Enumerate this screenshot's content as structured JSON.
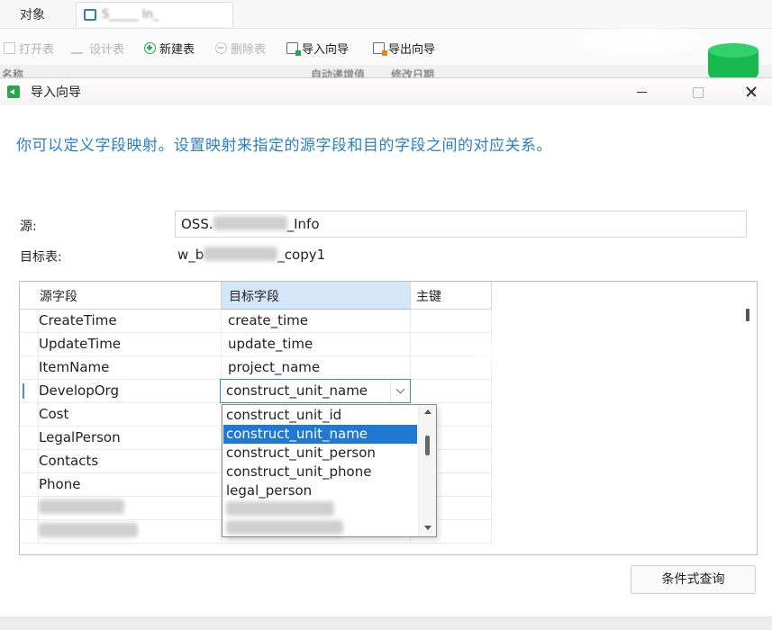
{
  "app": {
    "object_tab_label": "对象",
    "doc_tab_title": "S_____ In_",
    "toolbar": [
      {
        "label": "打开表",
        "enabled": false,
        "icon": "open-table-icon"
      },
      {
        "label": "设计表",
        "enabled": false,
        "icon": "design-table-icon"
      },
      {
        "label": "新建表",
        "enabled": true,
        "icon": "new-table-icon"
      },
      {
        "label": "删除表",
        "enabled": false,
        "icon": "delete-table-icon"
      },
      {
        "label": "导入向导",
        "enabled": true,
        "icon": "import-wizard-icon"
      },
      {
        "label": "导出向导",
        "enabled": true,
        "icon": "export-wizard-icon"
      }
    ],
    "column_headers": [
      "名称",
      "自动递增值",
      "修改日期"
    ],
    "colors": {
      "accent": "#1f78d1",
      "heading": "#2f7fc0",
      "success": "#2aa74a"
    }
  },
  "dialog": {
    "title": "导入向导",
    "instruction": "你可以定义字段映射。设置映射来指定的源字段和目的字段之间的对应关系。",
    "source_label": "源:",
    "source_value_prefix": "OSS.",
    "source_value_suffix": "_Info",
    "target_label": "目标表:",
    "target_value_prefix": "w_b",
    "target_value_suffix": "_copy1",
    "grid": {
      "headers": {
        "source": "源字段",
        "target": "目标字段",
        "key": "主键"
      },
      "rows": [
        {
          "source": "CreateTime",
          "target": "create_time"
        },
        {
          "source": "UpdateTime",
          "target": "update_time"
        },
        {
          "source": "ItemName",
          "target": "project_name"
        },
        {
          "source": "DevelopOrg",
          "target": "construct_unit_name"
        },
        {
          "source": "Cost",
          "target": ""
        },
        {
          "source": "LegalPerson",
          "target": ""
        },
        {
          "source": "Contacts",
          "target": ""
        },
        {
          "source": "Phone",
          "target": ""
        }
      ],
      "current_row": 3
    },
    "combo": {
      "value": "construct_unit_name",
      "options": [
        "construct_unit_id",
        "construct_unit_name",
        "construct_unit_person",
        "construct_unit_phone",
        "legal_person"
      ],
      "selected_index": 1
    },
    "bottom_button": "条件式查询"
  }
}
